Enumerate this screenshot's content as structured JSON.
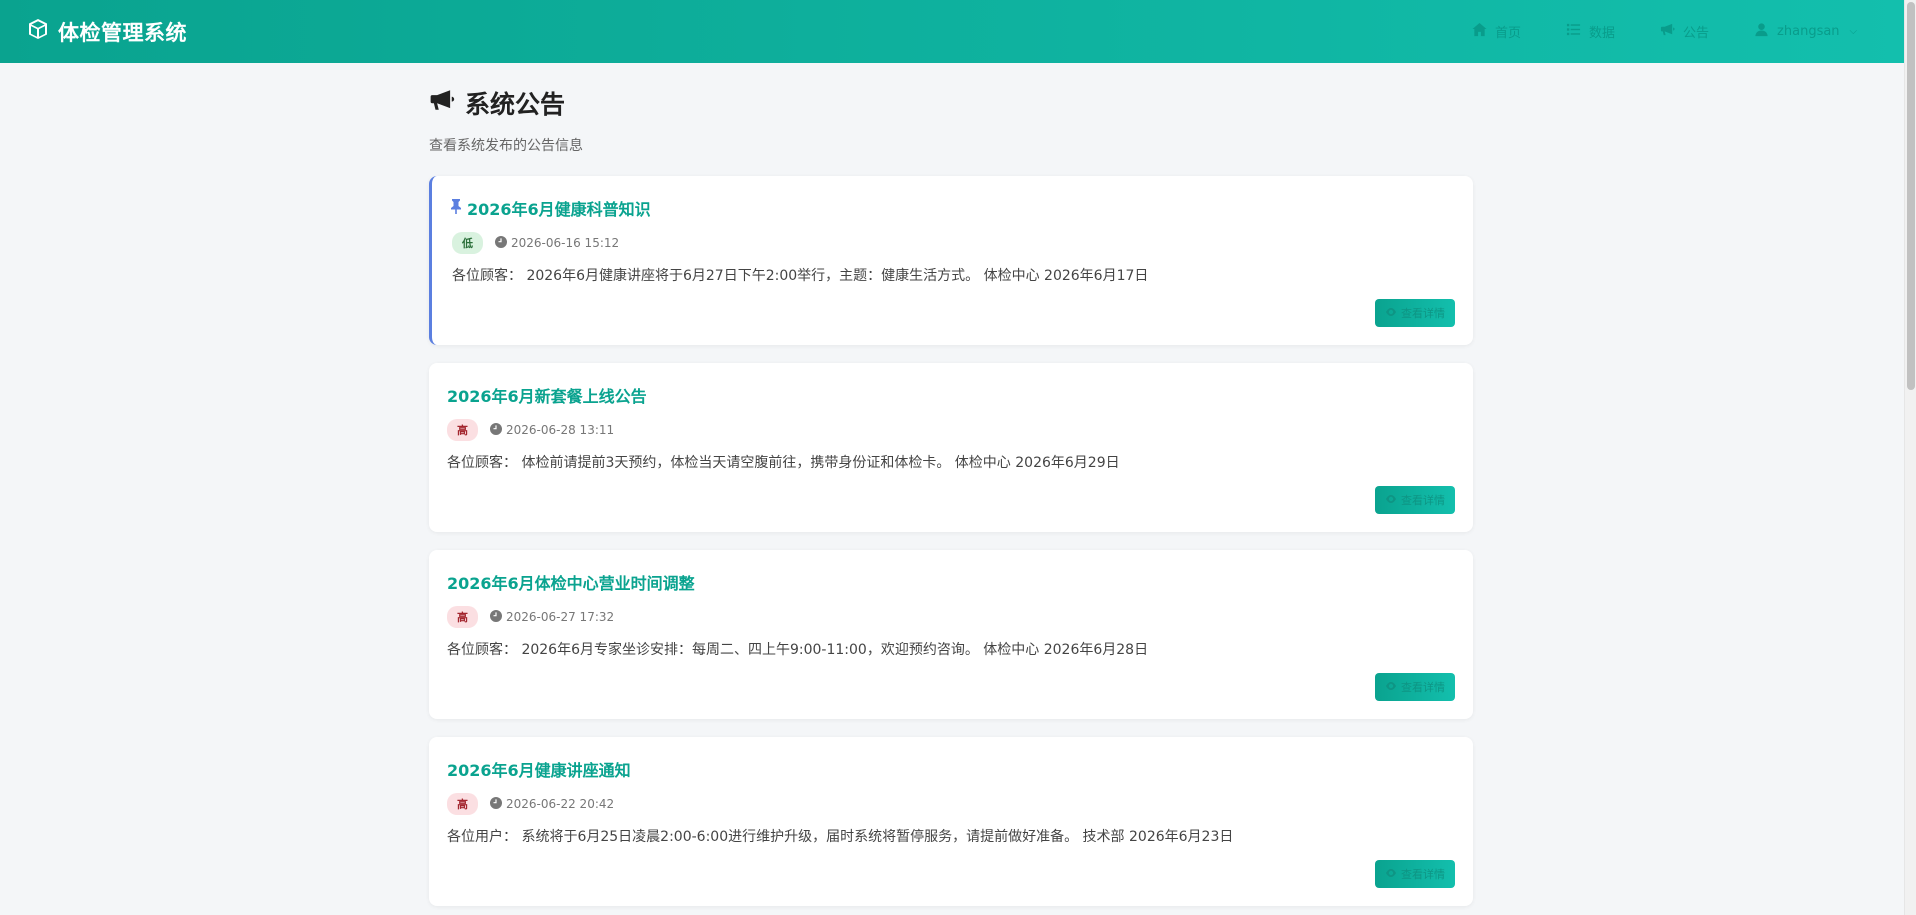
{
  "navbar": {
    "brand": "体检管理系统",
    "items": [
      {
        "label": "首页",
        "icon": "home-icon"
      },
      {
        "label": "数据",
        "icon": "list-icon"
      },
      {
        "label": "公告",
        "icon": "megaphone-icon"
      }
    ],
    "user": {
      "name": "zhangsan",
      "icon": "user-icon",
      "caret": "⌵"
    }
  },
  "page": {
    "title": "系统公告",
    "subtitle": "查看系统发布的公告信息"
  },
  "announcements": [
    {
      "title": "2026年6月健康科普知识",
      "pinned": true,
      "priority": "低",
      "time": "2026-06-16 15:12",
      "content": "各位顾客： 2026年6月健康讲座将于6月27日下午2:00举行，主题：健康生活方式。 体检中心 2026年6月17日",
      "button": "查看详情"
    },
    {
      "title": "2026年6月新套餐上线公告",
      "pinned": false,
      "priority": "高",
      "time": "2026-06-28 13:11",
      "content": "各位顾客： 体检前请提前3天预约，体检当天请空腹前往，携带身份证和体检卡。 体检中心 2026年6月29日",
      "button": "查看详情"
    },
    {
      "title": "2026年6月体检中心营业时间调整",
      "pinned": false,
      "priority": "高",
      "time": "2026-06-27 17:32",
      "content": "各位顾客： 2026年6月专家坐诊安排：每周二、四上午9:00-11:00，欢迎预约咨询。 体检中心 2026年6月28日",
      "button": "查看详情"
    },
    {
      "title": "2026年6月健康讲座通知",
      "pinned": false,
      "priority": "高",
      "time": "2026-06-22 20:42",
      "content": "各位用户： 系统将于6月25日凌晨2:00-6:00进行维护升级，届时系统将暂停服务，请提前做好准备。 技术部 2026年6月23日",
      "button": "查看详情"
    }
  ],
  "colors": {
    "primary": "#0aa38f",
    "pin": "#5b7fe0",
    "low_badge": "#d9f2df",
    "high_badge": "#fbdfe2"
  }
}
